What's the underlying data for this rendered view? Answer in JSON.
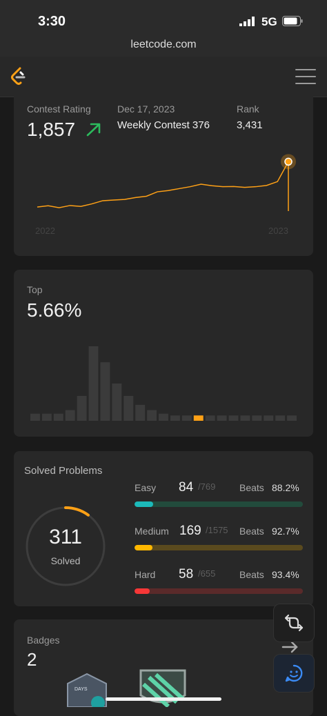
{
  "status": {
    "time": "3:30",
    "network": "5G"
  },
  "browser": {
    "url": "leetcode.com"
  },
  "nav": {
    "logo_icon": "leetcode-logo-icon",
    "menu_icon": "hamburger-menu-icon"
  },
  "contest": {
    "rating_label": "Contest Rating",
    "rating_value": "1,857",
    "date": "Dec 17, 2023",
    "contest_name": "Weekly Contest 376",
    "rank_label": "Rank",
    "rank_value": "3,431",
    "trend_icon": "trend-up-arrow-icon",
    "year_start": "2022",
    "year_end": "2023",
    "accent_color": "#ffa116",
    "trend_color": "#2cbb5d"
  },
  "chart_data": [
    {
      "type": "line",
      "x_ticks": [
        "2022",
        "2023"
      ],
      "series": [
        {
          "values": [
            1500,
            1510,
            1495,
            1512,
            1505,
            1525,
            1550,
            1555,
            1560,
            1575,
            1585,
            1620,
            1630,
            1645,
            1660,
            1680,
            1668,
            1660,
            1662,
            1655,
            1660,
            1670,
            1700,
            1857
          ]
        }
      ],
      "highlight_last_point": true
    },
    {
      "type": "bar",
      "values": [
        4,
        4,
        4,
        6,
        14,
        42,
        33,
        21,
        14,
        9,
        6,
        4,
        3,
        3,
        3,
        3,
        3,
        3,
        3,
        3,
        3,
        3,
        3
      ],
      "highlight_index": 14,
      "highlight_color": "#ffa116",
      "bar_color": "#3b3b3b"
    }
  ],
  "top": {
    "label": "Top",
    "value": "5.66%"
  },
  "solved": {
    "title": "Solved Problems",
    "total": "311",
    "total_label": "Solved",
    "ring_fraction": 0.1,
    "difficulties": [
      {
        "name": "Easy",
        "count": "84",
        "total": "/769",
        "beats_label": "Beats",
        "beats": "88.2%",
        "fraction": 0.109,
        "color": "#1cbaba",
        "track": "#224b3c"
      },
      {
        "name": "Medium",
        "count": "169",
        "total": "/1575",
        "beats_label": "Beats",
        "beats": "92.7%",
        "fraction": 0.107,
        "color": "#ffb800",
        "track": "#5a4a1e"
      },
      {
        "name": "Hard",
        "count": "58",
        "total": "/655",
        "beats_label": "Beats",
        "beats": "93.4%",
        "fraction": 0.089,
        "color": "#f63737",
        "track": "#5a2a2a"
      }
    ]
  },
  "badges": {
    "label": "Badges",
    "count": "2",
    "arrow_icon": "arrow-right-icon",
    "badge_text": "DAYS"
  },
  "floating": {
    "switch_icon": "switch-layout-icon",
    "feedback_icon": "smiley-chat-icon"
  }
}
